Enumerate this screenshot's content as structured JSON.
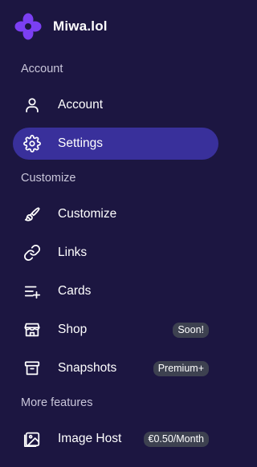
{
  "brand": {
    "name": "Miwa.lol",
    "logo_icon": "flower-logo-icon",
    "logo_color": "#7b3ff2"
  },
  "colors": {
    "background": "#1c1641",
    "active": "#39309b",
    "badge": "#3d4150"
  },
  "sections": {
    "account": "Account",
    "customize": "Customize",
    "more": "More features"
  },
  "nav": {
    "account": {
      "label": "Account",
      "icon": "user-icon"
    },
    "settings": {
      "label": "Settings",
      "icon": "gear-icon",
      "active": true
    },
    "customize": {
      "label": "Customize",
      "icon": "paintbrush-icon"
    },
    "links": {
      "label": "Links",
      "icon": "link-icon"
    },
    "cards": {
      "label": "Cards",
      "icon": "list-add-icon"
    },
    "shop": {
      "label": "Shop",
      "icon": "store-icon",
      "badge": "Soon!"
    },
    "snapshots": {
      "label": "Snapshots",
      "icon": "archive-icon",
      "badge": "Premium+"
    },
    "image_host": {
      "label": "Image Host",
      "icon": "image-icon",
      "badge": "€0.50/Month"
    }
  }
}
